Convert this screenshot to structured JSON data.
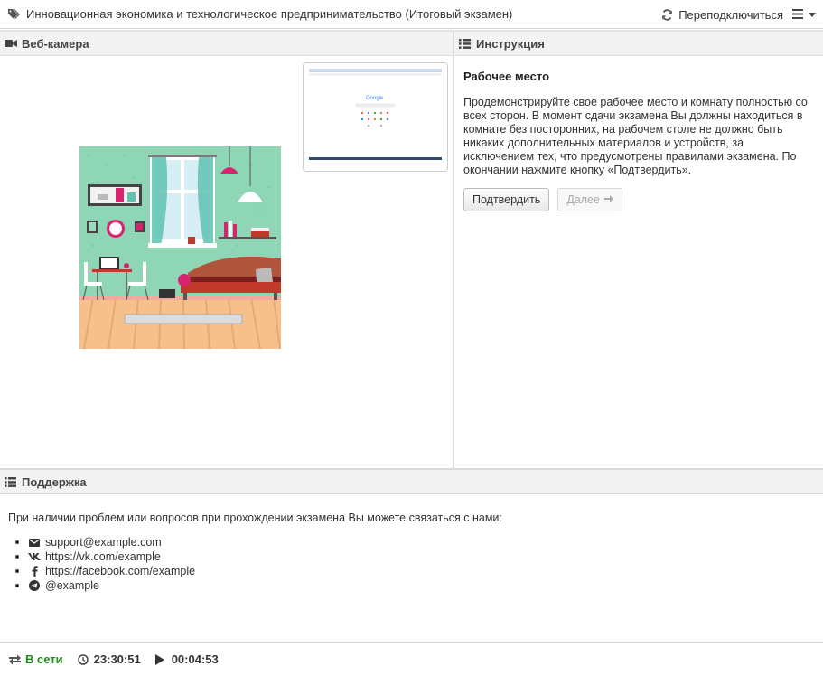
{
  "header": {
    "title": "Инновационная экономика и технологическое предпринимательство (Итоговый экзамен)",
    "reconnect_label": "Переподключиться",
    "icons": {
      "title": "tag-icon",
      "reconnect": "refresh-icon",
      "menu": "hamburger-icon"
    }
  },
  "webcam": {
    "title": "Веб-камера",
    "icon": "video-camera-icon"
  },
  "instruction": {
    "title": "Инструкция",
    "icon": "list-icon",
    "heading": "Рабочее место",
    "text": "Продемонстрируйте свое рабочее место и комнату полностью со всех сторон. В момент сдачи экзамена Вы должны находиться в комнате без посторонних, на рабочем столе не должно быть никаких дополнительных материалов и устройств, за исключением тех, что предусмотрены правилами экзамена. По окончании нажмите кнопку «Подтвердить».",
    "confirm_button": "Подтвердить",
    "next_button": "Далее"
  },
  "support": {
    "title": "Поддержка",
    "icon": "list-icon",
    "intro": "При наличии проблем или вопросов при прохождении экзамена Вы можете связаться с нами:",
    "contacts": [
      {
        "icon": "envelope-icon",
        "text": "support@example.com"
      },
      {
        "icon": "vk-icon",
        "text": "https://vk.com/example"
      },
      {
        "icon": "facebook-icon",
        "text": "https://facebook.com/example"
      },
      {
        "icon": "telegram-icon",
        "text": "@example"
      }
    ]
  },
  "status": {
    "online_label": "В сети",
    "clock": "23:30:51",
    "elapsed": "00:04:53",
    "online_color": "#1e8a1e"
  }
}
